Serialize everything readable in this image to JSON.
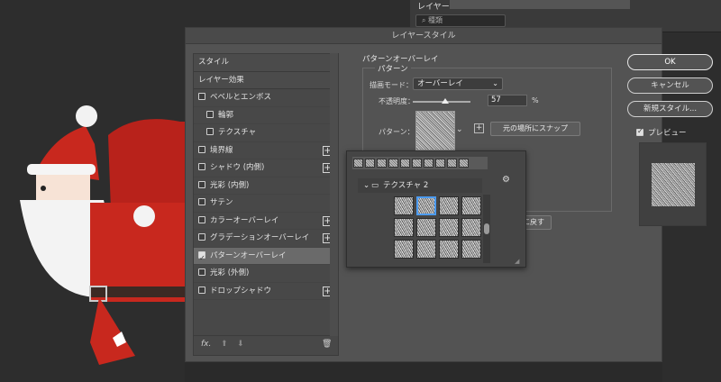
{
  "layers_panel": {
    "tab_label": "レイヤー",
    "kind_placeholder": "種類"
  },
  "dialog": {
    "title": "レイヤースタイル",
    "effects": [
      {
        "label": "スタイル",
        "type": "header"
      },
      {
        "label": "レイヤー効果",
        "type": "header"
      },
      {
        "label": "ベベルとエンボス",
        "checked": false
      },
      {
        "label": "輪郭",
        "checked": false,
        "indent": true
      },
      {
        "label": "テクスチャ",
        "checked": false,
        "indent": true
      },
      {
        "label": "境界線",
        "checked": false,
        "plus": true
      },
      {
        "label": "シャドウ (内側)",
        "checked": false,
        "plus": true
      },
      {
        "label": "光彩 (内側)",
        "checked": false
      },
      {
        "label": "サテン",
        "checked": false
      },
      {
        "label": "カラーオーバーレイ",
        "checked": false,
        "plus": true
      },
      {
        "label": "グラデーションオーバーレイ",
        "checked": false,
        "plus": true
      },
      {
        "label": "パターンオーバーレイ",
        "checked": true,
        "selected": true
      },
      {
        "label": "光彩 (外側)",
        "checked": false
      },
      {
        "label": "ドロップシャドウ",
        "checked": false,
        "plus": true
      }
    ],
    "footer": {
      "fx_label": "fx."
    },
    "settings": {
      "section_title": "パターンオーバーレイ",
      "group_title": "パターン",
      "blend_mode_label": "描画モード：",
      "blend_mode_value": "オーバーレイ",
      "opacity_label": "不透明度：",
      "opacity_value": "57",
      "opacity_unit": "%",
      "opacity_fraction": 0.57,
      "pattern_label": "パターン：",
      "snap_button": "元の場所にスナップ",
      "reset_button_partial": "に戻す"
    },
    "pattern_picker": {
      "folder_name": "テクスチャ 2"
    },
    "buttons": {
      "ok": "OK",
      "cancel": "キャンセル",
      "new_style": "新規スタイル...",
      "preview_label": "プレビュー",
      "preview_checked": true
    }
  },
  "colors": {
    "dialog_bg": "#535353",
    "selection_accent": "#4c9bf0",
    "santa_red": "#c8281e"
  }
}
